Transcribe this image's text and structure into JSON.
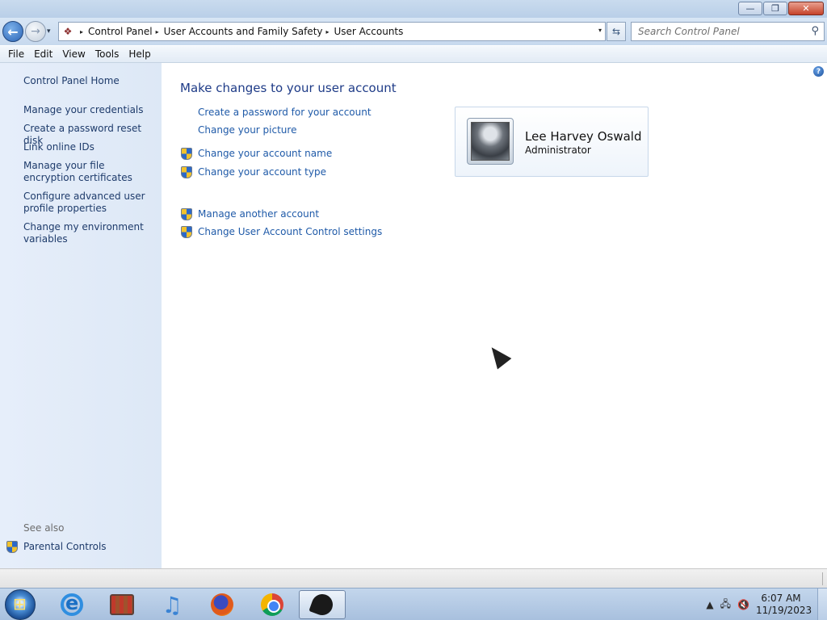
{
  "window": {
    "minimize_glyph": "—",
    "maximize_glyph": "❐",
    "close_glyph": "✕"
  },
  "navigation": {
    "back_glyph": "←",
    "forward_glyph": "→",
    "history_glyph": "▾",
    "breadcrumb": [
      "Control Panel",
      "User Accounts and Family Safety",
      "User Accounts"
    ],
    "crumb_separator": "▸",
    "dropdown_glyph": "▾",
    "refresh_glyph": "⇆",
    "search_placeholder": "Search Control Panel",
    "search_icon_glyph": "⚲"
  },
  "menubar": [
    "File",
    "Edit",
    "View",
    "Tools",
    "Help"
  ],
  "left_pane": {
    "home": "Control Panel Home",
    "links": [
      "Manage your credentials",
      "Create a password reset disk",
      "Link online IDs",
      "Manage your file encryption certificates",
      "Configure advanced user profile properties",
      "Change my environment variables"
    ],
    "see_also_label": "See also",
    "see_also_links": [
      "Parental Controls"
    ]
  },
  "main": {
    "help_glyph": "?",
    "title": "Make changes to your user account",
    "tasks": [
      {
        "label": "Create a password for your account",
        "shield": false
      },
      {
        "label": "Change your picture",
        "shield": false
      },
      {
        "label": "Change your account name",
        "shield": true
      },
      {
        "label": "Change your account type",
        "shield": true
      }
    ],
    "other_tasks": [
      {
        "label": "Manage another account",
        "shield": true
      },
      {
        "label": "Change User Account Control settings",
        "shield": true
      }
    ],
    "user": {
      "name": "Lee Harvey Oswald",
      "role": "Administrator"
    }
  },
  "taskbar": {
    "apps": [
      "start-orb",
      "internet-explorer",
      "video-editor",
      "itunes",
      "firefox",
      "chrome",
      "ink-app"
    ],
    "active_app": "ink-app",
    "tray_arrow": "▲",
    "network_glyph": "🖧",
    "volume_glyph": "🔇",
    "time": "6:07 AM",
    "date": "11/19/2023"
  },
  "colors": {
    "link": "#1f5aa8",
    "title": "#1e3b87",
    "left_pane_bg": "#e2ebf8"
  }
}
